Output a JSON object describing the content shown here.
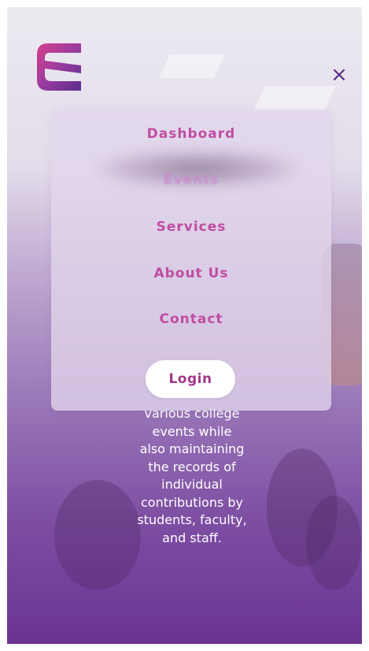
{
  "header": {
    "logo_icon": "stylized-e-logo-icon",
    "close_icon": "close-icon",
    "close_label": "×"
  },
  "menu": {
    "items": [
      {
        "label": "Dashboard"
      },
      {
        "label": "Events"
      },
      {
        "label": "Services"
      },
      {
        "label": "About Us"
      },
      {
        "label": "Contact"
      }
    ],
    "login_label": "Login"
  },
  "hero": {
    "lines": [
      "various college",
      "events while",
      "also maintaining",
      "the records of",
      "individual",
      "contributions by",
      "students, faculty,",
      "and staff."
    ]
  },
  "colors": {
    "menu_text": "#c04da2",
    "login_text": "#a2378a",
    "close": "#5b2d86",
    "gradient_bottom": "#6b3393"
  }
}
